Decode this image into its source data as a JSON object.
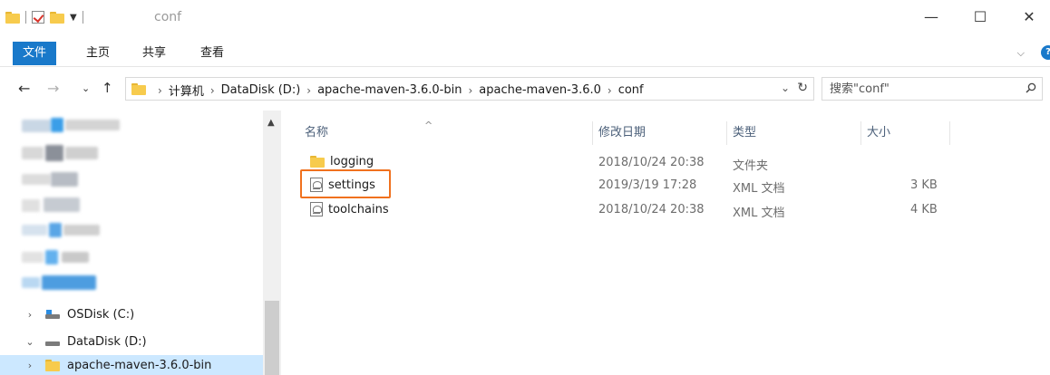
{
  "window": {
    "title": "conf",
    "minimize_glyph": "—",
    "maximize_glyph": "☐",
    "close_glyph": "✕"
  },
  "ribbon": {
    "tabs": [
      "文件",
      "主页",
      "共享",
      "查看"
    ],
    "expand_glyph": "⌵"
  },
  "address": {
    "crumbs": [
      "计算机",
      "DataDisk (D:)",
      "apache-maven-3.6.0-bin",
      "apache-maven-3.6.0",
      "conf"
    ],
    "separator": "›"
  },
  "search": {
    "placeholder": "搜索\"conf\""
  },
  "columns": {
    "name": "名称",
    "modified": "修改日期",
    "type": "类型",
    "size": "大小"
  },
  "files": [
    {
      "name": "logging",
      "modified": "2018/10/24 20:38",
      "type": "文件夹",
      "size": "",
      "icon": "folder-icon"
    },
    {
      "name": "settings",
      "modified": "2019/3/19 17:28",
      "type": "XML 文档",
      "size": "3 KB",
      "icon": "xml-file-icon",
      "highlighted": true
    },
    {
      "name": "toolchains",
      "modified": "2018/10/24 20:38",
      "type": "XML 文档",
      "size": "4 KB",
      "icon": "xml-file-icon"
    }
  ],
  "nav": {
    "items": [
      {
        "label": "OSDisk (C:)",
        "expander": "›",
        "icon": "windows-drive-icon"
      },
      {
        "label": "DataDisk (D:)",
        "expander": "⌄",
        "icon": "drive-icon"
      },
      {
        "label": "apache-maven-3.6.0-bin",
        "expander": "›",
        "icon": "folder-icon",
        "selected": true
      }
    ]
  },
  "colors": {
    "accent": "#1979ca",
    "highlight_box": "#f0711e",
    "nav_selected": "#cce8ff",
    "folder": "#f7cb4d"
  }
}
